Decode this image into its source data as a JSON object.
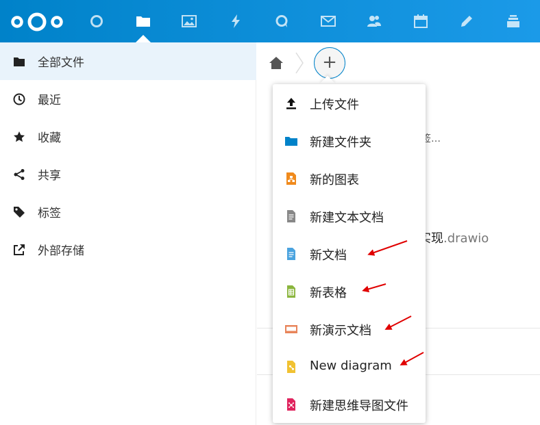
{
  "header": {
    "apps": [
      {
        "icon": "dashboard-circle-icon"
      },
      {
        "icon": "files-folder-icon"
      },
      {
        "icon": "photos-icon"
      },
      {
        "icon": "activity-bolt-icon"
      },
      {
        "icon": "talk-icon"
      },
      {
        "icon": "mail-icon"
      },
      {
        "icon": "contacts-icon"
      },
      {
        "icon": "calendar-icon"
      },
      {
        "icon": "notes-pencil-icon"
      },
      {
        "icon": "deck-stack-icon"
      }
    ],
    "brand_color": "#0082c9"
  },
  "sidebar": {
    "items": [
      {
        "label": "全部文件",
        "icon": "folder-icon"
      },
      {
        "label": "最近",
        "icon": "clock-icon"
      },
      {
        "label": "收藏",
        "icon": "star-icon"
      },
      {
        "label": "共享",
        "icon": "share-icon"
      },
      {
        "label": "标签",
        "icon": "tag-icon"
      },
      {
        "label": "外部存储",
        "icon": "external-link-icon"
      }
    ]
  },
  "main": {
    "add_button": "+",
    "bg_text_1": "签…",
    "bg_text_2_name": "实现",
    "bg_text_2_ext": ".drawio"
  },
  "menu": {
    "items": [
      {
        "label": "上传文件",
        "icon": "upload-icon",
        "color": "#111111"
      },
      {
        "label": "新建文件夹",
        "icon": "folder-icon",
        "color": "#0082c9"
      },
      {
        "label": "新的图表",
        "icon": "diagram-chart-icon",
        "color": "#f08a1c"
      },
      {
        "label": "新建文本文档",
        "icon": "text-document-icon",
        "color": "#888888"
      },
      {
        "label": "新文档",
        "icon": "document-icon",
        "color": "#4aa3df"
      },
      {
        "label": "新表格",
        "icon": "spreadsheet-icon",
        "color": "#8ab53d"
      },
      {
        "label": "新演示文档",
        "icon": "presentation-icon",
        "color": "#e8845a"
      },
      {
        "label": "New diagram",
        "icon": "drawio-diagram-icon",
        "color": "#f1c232"
      },
      {
        "label": "新建思维导图文件",
        "icon": "mindmap-icon",
        "color": "#e0245e"
      }
    ]
  },
  "annotation_color": "#e00000"
}
